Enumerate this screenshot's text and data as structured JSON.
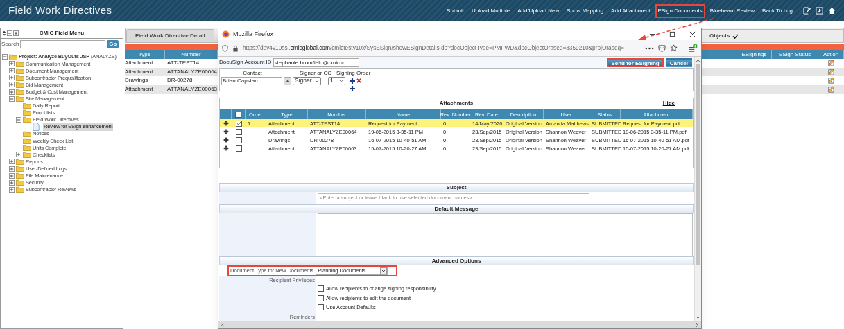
{
  "header": {
    "title": "Field Work Directives",
    "actions": [
      {
        "label": "Submit",
        "highlighted": false
      },
      {
        "label": "Upload Multiple",
        "highlighted": false
      },
      {
        "label": "Add/Upload New",
        "highlighted": false
      },
      {
        "label": "Show Mapping",
        "highlighted": false
      },
      {
        "label": "Add Attachment",
        "highlighted": false
      },
      {
        "label": "ESign Documents",
        "highlighted": true
      },
      {
        "label": "Bluebeam Review",
        "highlighted": false
      },
      {
        "label": "Back To Log",
        "highlighted": false
      }
    ]
  },
  "sidebar": {
    "title": "CMiC Field Menu",
    "search_label": "Search",
    "go_button": "Go",
    "tree": [
      {
        "label": "**Project: Analyze BuyOuts JSP** (ANALYZE)",
        "kind": "folder",
        "expanded": true,
        "selected": false,
        "children": [
          {
            "label": "Communication Management",
            "kind": "folder",
            "expanded": false,
            "selected": false
          },
          {
            "label": "Document Management",
            "kind": "folder",
            "expanded": false,
            "selected": false
          },
          {
            "label": "Subcontractor Prequalification",
            "kind": "folder",
            "expanded": false,
            "selected": false
          },
          {
            "label": "Bid Management",
            "kind": "folder",
            "expanded": false,
            "selected": false
          },
          {
            "label": "Budget & Cost Management",
            "kind": "folder",
            "expanded": false,
            "selected": false
          },
          {
            "label": "Site Management",
            "kind": "folder",
            "expanded": true,
            "selected": false,
            "children": [
              {
                "label": "Daily Report",
                "kind": "folder",
                "selected": false
              },
              {
                "label": "Punchlists",
                "kind": "folder",
                "selected": false
              },
              {
                "label": "Field Work Directives",
                "kind": "folder",
                "expanded": true,
                "selected": false,
                "children": [
                  {
                    "label": "Review for ESign enhancement",
                    "kind": "document",
                    "selected": true
                  }
                ]
              },
              {
                "label": "Notices",
                "kind": "folder",
                "selected": false
              },
              {
                "label": "Weekly Check List",
                "kind": "folder",
                "selected": false
              },
              {
                "label": "Units Complete",
                "kind": "folder",
                "selected": false
              },
              {
                "label": "Checklists",
                "kind": "folder",
                "expanded": false,
                "selected": false
              }
            ]
          },
          {
            "label": "Reports",
            "kind": "folder",
            "expanded": false,
            "selected": false
          },
          {
            "label": "User-Defined Logs",
            "kind": "folder",
            "expanded": false,
            "selected": false
          },
          {
            "label": "File Maintenance",
            "kind": "folder",
            "expanded": false,
            "selected": false
          },
          {
            "label": "Security",
            "kind": "folder",
            "expanded": false,
            "selected": false
          },
          {
            "label": "Subcontractor Reviews",
            "kind": "folder",
            "expanded": false,
            "selected": false
          }
        ]
      }
    ]
  },
  "tabs": [
    {
      "label": "Field Work Directive Detail",
      "selected": true
    },
    {
      "label": "Objects",
      "selected": false
    }
  ],
  "table": {
    "columns": [
      "Type",
      "Number",
      "ESignings",
      "ESign Status",
      "Action"
    ],
    "rows": [
      {
        "type": "Attachment",
        "number": "ATT-TEST14"
      },
      {
        "type": "Attachment",
        "number": "ATTANALYZE00064"
      },
      {
        "type": "Drawings",
        "number": "DR-00278"
      },
      {
        "type": "Attachment",
        "number": "ATTANALYZE00063"
      }
    ]
  },
  "popup": {
    "title": "Mozilla Firefox",
    "url": "https://dev4v10ssl.**cmicglobal.com**/cmictestv10x/SysESign/showESignDetails.do?docObjectType=PMFWD&docObjectOraseq=8359210&projOraseq=",
    "account": {
      "label": "DocuSign Account ID",
      "value": "stephanie.bromfield@cmic.c"
    },
    "buttons": [
      {
        "label": "Send for ESigning",
        "highlighted": true
      },
      {
        "label": "Cancel",
        "highlighted": false
      }
    ],
    "signers": {
      "columns": [
        "Contact",
        "Signer or CC",
        "Signing Order"
      ],
      "rows": [
        {
          "contact": "Brian Capstan",
          "role": "Signer",
          "order": "1"
        }
      ]
    },
    "attachments": {
      "title": "Attachments",
      "hide_link": "Hide",
      "header_checked": false,
      "columns": [
        "Order",
        "Type",
        "Number",
        "Name",
        "Rev. Number",
        "Rev. Date",
        "Description",
        "User",
        "Status",
        "Attachment"
      ],
      "rows": [
        {
          "selected": true,
          "checked": true,
          "order": "1",
          "type": "Attachment",
          "number": "ATT-TEST14",
          "name": "Request for Payment",
          "rev_number": "0",
          "rev_date": "14/May/2020",
          "description": "Original Version",
          "user": "Amanda Matthews",
          "status": "SUBMITTED",
          "attachment": "Request for Payment.pdf"
        },
        {
          "selected": false,
          "checked": false,
          "type": "Attachment",
          "number": "ATTANALYZE00064",
          "name": "19-06-2015 3-35-11 PM",
          "rev_number": "0",
          "rev_date": "23/Sep/2015",
          "description": "Original Version",
          "user": "Shannon Weaver",
          "status": "SUBMITTED",
          "attachment": "19-06-2015 3-35-11 PM.pdf"
        },
        {
          "selected": false,
          "checked": false,
          "type": "Drawings",
          "number": "DR-00278",
          "name": "16-07-2015 10-40-51 AM",
          "rev_number": "0",
          "rev_date": "23/Sep/2015",
          "description": "Original Version",
          "user": "Shannon Weaver",
          "status": "SUBMITTED",
          "attachment": "16-07-2015 10-40-51 AM.pdf"
        },
        {
          "selected": false,
          "checked": false,
          "type": "Attachment",
          "number": "ATTANALYZE00063",
          "name": "15-07-2015 10-20-27 AM",
          "rev_number": "0",
          "rev_date": "23/Sep/2015",
          "description": "Original Version",
          "user": "Shannon Weaver",
          "status": "SUBMITTED",
          "attachment": "15-07-2015 10-20-27 AM.pdf"
        }
      ]
    },
    "subject": {
      "title": "Subject",
      "placeholder": "<Enter a subject or leave blank to use selected document names>"
    },
    "message": {
      "title": "Default Message"
    },
    "advanced": {
      "title": "Advanced Options",
      "document_type": {
        "label": "Document Type for New Documents",
        "value": "Planning Documents",
        "highlighted": true
      },
      "privileges_label": "Recipient Privileges",
      "privileges": [
        {
          "label": "Allow recipients to change signing responsibility",
          "checked": false
        },
        {
          "label": "Allow recipients to edit the document",
          "checked": false
        },
        {
          "label": "Use Account Defaults",
          "checked": false
        }
      ],
      "reminders_label": "Reminders"
    }
  }
}
